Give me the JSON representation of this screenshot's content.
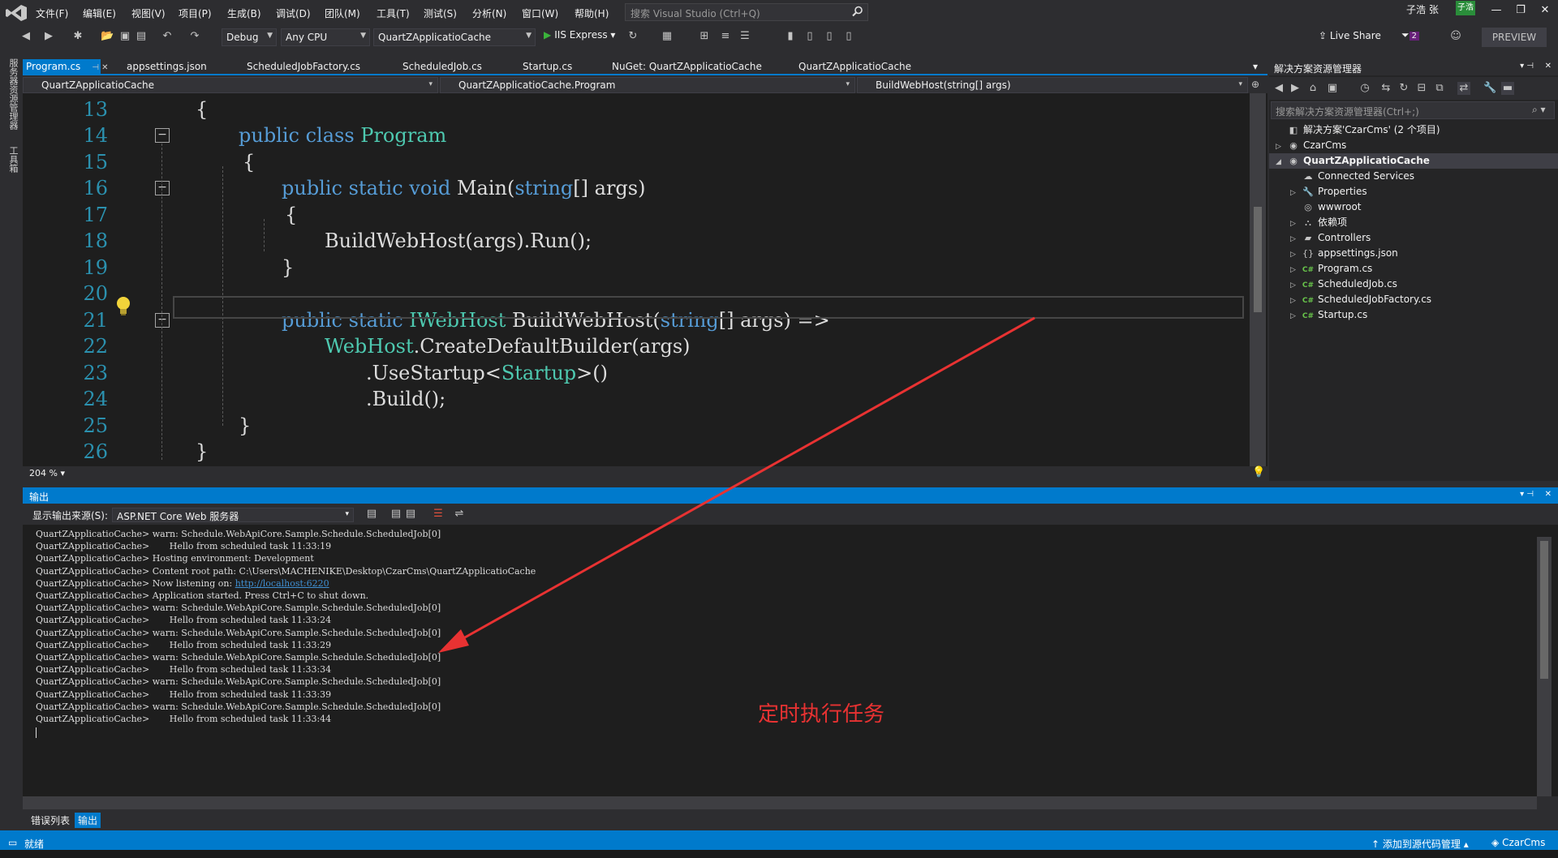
{
  "menu": [
    "文件(F)",
    "编辑(E)",
    "视图(V)",
    "项目(P)",
    "生成(B)",
    "调试(D)",
    "团队(M)",
    "工具(T)",
    "测试(S)",
    "分析(N)",
    "窗口(W)",
    "帮助(H)"
  ],
  "search": {
    "placeholder": "搜索 Visual Studio (Ctrl+Q)"
  },
  "user": {
    "name": "子浩 张",
    "avatar": "子浩"
  },
  "toolbar": {
    "config": "Debug",
    "platform": "Any CPU",
    "project": "QuartZApplicatioCache",
    "run_label": "IIS Express",
    "live_share": "Live Share",
    "notifications": "2",
    "preview": "PREVIEW"
  },
  "left_tabs": [
    "服务器资源管理器",
    "工具箱"
  ],
  "tabs": [
    {
      "label": "Program.cs",
      "active": true
    },
    {
      "label": "appsettings.json",
      "active": false
    },
    {
      "label": "ScheduledJobFactory.cs",
      "active": false
    },
    {
      "label": "ScheduledJob.cs",
      "active": false
    },
    {
      "label": "Startup.cs",
      "active": false
    },
    {
      "label": "NuGet: QuartZApplicatioCache",
      "active": false
    },
    {
      "label": "QuartZApplicatioCache",
      "active": false
    }
  ],
  "navbar": {
    "project": "QuartZApplicatioCache",
    "type": "QuartZApplicatioCache.Program",
    "member": "BuildWebHost(string[] args)"
  },
  "code": {
    "line_numbers": [
      "13",
      "14",
      "15",
      "16",
      "17",
      "18",
      "19",
      "20",
      "21",
      "22",
      "23",
      "24",
      "25",
      "26"
    ],
    "l13": "{",
    "l14": {
      "kw": "public class ",
      "ty": "Program"
    },
    "l15": "{",
    "l16": {
      "kw": "public static void ",
      "name": "Main(",
      "kw2": "string",
      "rest": "[] args)"
    },
    "l17": "{",
    "l18": "BuildWebHost(args).Run();",
    "l19": "}",
    "l21": {
      "kw": "public static ",
      "ty": "IWebHost",
      "name": " BuildWebHost(",
      "kw2": "string",
      "rest": "[] args) =>"
    },
    "l22": {
      "ty": "WebHost",
      "rest": ".CreateDefaultBuilder(args)"
    },
    "l23": {
      "pre": ".UseStartup<",
      "ty": "Startup",
      "post": ">()"
    },
    "l24": ".Build();",
    "l25": "}",
    "l26": "}",
    "zoom": "204 %"
  },
  "solution_explorer": {
    "title": "解决方案资源管理器",
    "search_placeholder": "搜索解决方案资源管理器(Ctrl+;)",
    "items": [
      {
        "label": "解决方案'CzarCms' (2 个项目)",
        "icon": "solution-icon",
        "depth": 0,
        "arrow": ""
      },
      {
        "label": "CzarCms",
        "icon": "project-icon",
        "depth": 0,
        "arrow": "▷"
      },
      {
        "label": "QuartZApplicatioCache",
        "icon": "project-icon",
        "depth": 0,
        "arrow": "◢",
        "selected": true
      },
      {
        "label": "Connected Services",
        "icon": "cloud-icon",
        "depth": 1,
        "arrow": ""
      },
      {
        "label": "Properties",
        "icon": "wrench-icon",
        "depth": 1,
        "arrow": "▷"
      },
      {
        "label": "wwwroot",
        "icon": "globe-icon",
        "depth": 1,
        "arrow": ""
      },
      {
        "label": "依赖项",
        "icon": "dependency-icon",
        "depth": 1,
        "arrow": "▷"
      },
      {
        "label": "Controllers",
        "icon": "folder-icon",
        "depth": 1,
        "arrow": "▷"
      },
      {
        "label": "appsettings.json",
        "icon": "json-file-icon",
        "depth": 1,
        "arrow": "▷"
      },
      {
        "label": "Program.cs",
        "icon": "csharp-file-icon",
        "depth": 1,
        "arrow": "▷"
      },
      {
        "label": "ScheduledJob.cs",
        "icon": "csharp-file-icon",
        "depth": 1,
        "arrow": "▷"
      },
      {
        "label": "ScheduledJobFactory.cs",
        "icon": "csharp-file-icon",
        "depth": 1,
        "arrow": "▷"
      },
      {
        "label": "Startup.cs",
        "icon": "csharp-file-icon",
        "depth": 1,
        "arrow": "▷"
      }
    ]
  },
  "output": {
    "title": "输出",
    "source_label": "显示输出来源(S):",
    "source_value": "ASP.NET Core Web 服务器",
    "lines": [
      "QuartZApplicatioCache> warn: Schedule.WebApiCore.Sample.Schedule.ScheduledJob[0]",
      "QuartZApplicatioCache>       Hello from scheduled task 11:33:19",
      "QuartZApplicatioCache> Hosting environment: Development",
      "QuartZApplicatioCache> Content root path: C:\\Users\\MACHENIKE\\Desktop\\CzarCms\\QuartZApplicatioCache",
      "QuartZApplicatioCache> Now listening on: ",
      "QuartZApplicatioCache> Application started. Press Ctrl+C to shut down.",
      "QuartZApplicatioCache> warn: Schedule.WebApiCore.Sample.Schedule.ScheduledJob[0]",
      "QuartZApplicatioCache>       Hello from scheduled task 11:33:24",
      "QuartZApplicatioCache> warn: Schedule.WebApiCore.Sample.Schedule.ScheduledJob[0]",
      "QuartZApplicatioCache>       Hello from scheduled task 11:33:29",
      "QuartZApplicatioCache> warn: Schedule.WebApiCore.Sample.Schedule.ScheduledJob[0]",
      "QuartZApplicatioCache>       Hello from scheduled task 11:33:34",
      "QuartZApplicatioCache> warn: Schedule.WebApiCore.Sample.Schedule.ScheduledJob[0]",
      "QuartZApplicatioCache>       Hello from scheduled task 11:33:39",
      "QuartZApplicatioCache> warn: Schedule.WebApiCore.Sample.Schedule.ScheduledJob[0]",
      "QuartZApplicatioCache>       Hello from scheduled task 11:33:44"
    ],
    "listen_url": "http://localhost:6220"
  },
  "annotation": "定时执行任务",
  "bottom_tabs": [
    {
      "label": "错误列表",
      "active": false
    },
    {
      "label": "输出",
      "active": true
    }
  ],
  "status": {
    "ready": "就绪",
    "source_control": "添加到源代码管理",
    "repo": "CzarCms"
  },
  "colors": {
    "accent": "#007acc",
    "arrow": "#e83232"
  }
}
